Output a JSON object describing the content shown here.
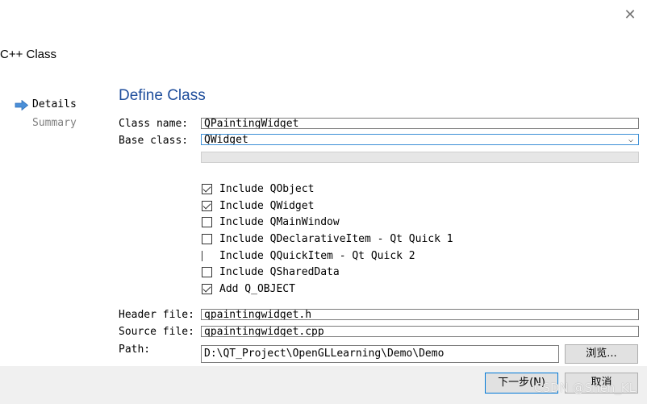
{
  "window": {
    "close_glyph": "✕",
    "title": "C++ Class"
  },
  "sidebar": {
    "items": [
      {
        "label": "Details",
        "active": true
      },
      {
        "label": "Summary",
        "active": false
      }
    ],
    "arrow_icon": "right-arrow-icon",
    "arrow_color": "#4a8fd8"
  },
  "page": {
    "title": "Define Class",
    "title_color": "#1f4e9c"
  },
  "form": {
    "class_name_label": "Class name:",
    "class_name_value": "QPaintingWidget",
    "base_class_label": "Base class:",
    "base_class_value": "QWidget",
    "checkboxes": [
      {
        "label": "Include QObject",
        "checked": true
      },
      {
        "label": "Include QWidget",
        "checked": true
      },
      {
        "label": "Include QMainWindow",
        "checked": false
      },
      {
        "label": "Include QDeclarativeItem - Qt Quick 1",
        "checked": false
      },
      {
        "label": "Include QQuickItem - Qt Quick 2",
        "checked": false
      },
      {
        "label": "Include QSharedData",
        "checked": false
      },
      {
        "label": "Add Q_OBJECT",
        "checked": true
      }
    ],
    "header_file_label": "Header file:",
    "header_file_value": "qpaintingwidget.h",
    "source_file_label": "Source file:",
    "source_file_value": "qpaintingwidget.cpp",
    "path_label": "Path:",
    "path_value": "D:\\QT_Project\\OpenGLLearning\\Demo\\Demo",
    "browse_label": "浏览..."
  },
  "buttons": {
    "next_label": "下一步(N)",
    "cancel_label": "取消"
  },
  "watermark": "CSDN @Shen_KL"
}
